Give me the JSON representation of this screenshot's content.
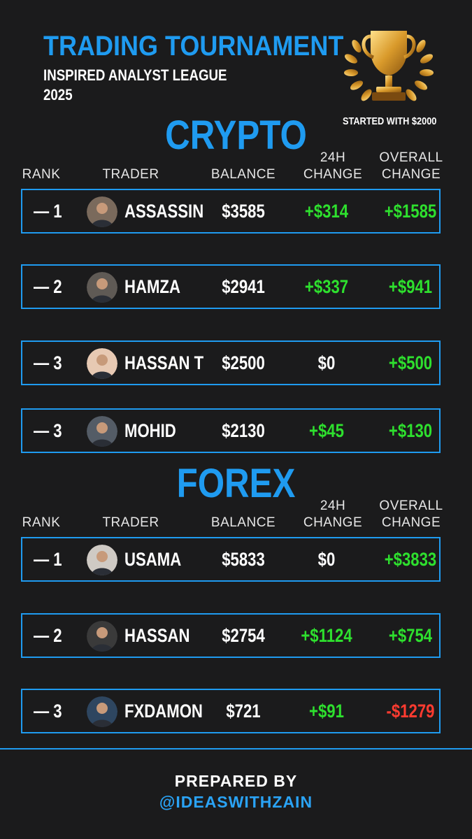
{
  "header": {
    "title": "TRADING TOURNAMENT",
    "subtitle": "INSPIRED ANALYST LEAGUE\n2025",
    "started_note": "STARTED WITH $2000",
    "trophy_icon": "trophy-icon"
  },
  "columns": {
    "rank": "RANK",
    "trader": "TRADER",
    "balance": "BALANCE",
    "change_24h": "24H\nCHANGE",
    "change_overall": "OVERALL\nCHANGE"
  },
  "crypto": {
    "title": "CRYPTO",
    "rows": [
      {
        "rank": "— 1",
        "trader": "ASSASSIN",
        "balance": "$3585",
        "change_24h": "+$314",
        "change_overall": "+$1585",
        "avatar_color": "#7a6a5c"
      },
      {
        "rank": "— 2",
        "trader": "HAMZA",
        "balance": "$2941",
        "change_24h": "+$337",
        "change_overall": "+$941",
        "avatar_color": "#5f5a55"
      },
      {
        "rank": "— 3",
        "trader": "HASSAN T",
        "balance": "$2500",
        "change_24h": "$0",
        "change_overall": "+$500",
        "avatar_color": "#e7c9b3"
      },
      {
        "rank": "— 3",
        "trader": "MOHID",
        "balance": "$2130",
        "change_24h": "+$45",
        "change_overall": "+$130",
        "avatar_color": "#545c66"
      }
    ]
  },
  "forex": {
    "title": "FOREX",
    "rows": [
      {
        "rank": "— 1",
        "trader": "USAMA",
        "balance": "$5833",
        "change_24h": "$0",
        "change_overall": "+$3833",
        "avatar_color": "#cfcac4"
      },
      {
        "rank": "— 2",
        "trader": "HASSAN",
        "balance": "$2754",
        "change_24h": "+$1124",
        "change_overall": "+$754",
        "avatar_color": "#3a3a3a"
      },
      {
        "rank": "— 3",
        "trader": "FXDAMON",
        "balance": "$721",
        "change_24h": "+$91",
        "change_overall": "-$1279",
        "avatar_color": "#2e4660"
      }
    ]
  },
  "footer": {
    "prepared_by": "PREPARED BY",
    "handle": "@IDEASWITHZAIN"
  },
  "colors": {
    "accent": "#1f9bf0",
    "positive": "#2ee02e",
    "negative": "#ff3b30",
    "background": "#1b1b1c"
  }
}
